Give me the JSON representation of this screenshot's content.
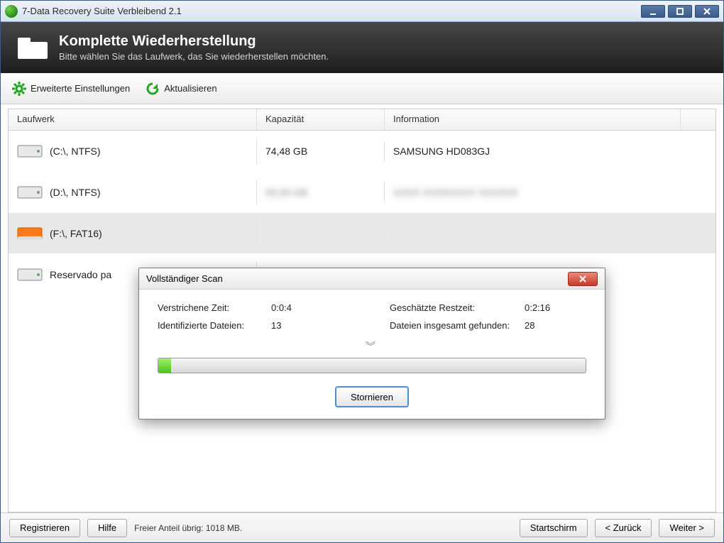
{
  "window": {
    "title": "7-Data Recovery Suite Verbleibend 2.1"
  },
  "banner": {
    "title": "Komplette Wiederherstellung",
    "subtitle": "Bitte wählen Sie das Laufwerk, das Sie wiederherstellen möchten."
  },
  "toolbar": {
    "advanced": "Erweiterte Einstellungen",
    "refresh": "Aktualisieren"
  },
  "columns": {
    "drive": "Laufwerk",
    "capacity": "Kapazität",
    "info": "Information"
  },
  "drives": [
    {
      "label": "(C:\\, NTFS)",
      "capacity": "74,48 GB",
      "info": "SAMSUNG HD083GJ",
      "selected": false,
      "highlight": false
    },
    {
      "label": "(D:\\, NTFS)",
      "capacity": "",
      "info": "",
      "selected": false,
      "highlight": false
    },
    {
      "label": "(F:\\, FAT16)",
      "capacity": "",
      "info": "",
      "selected": true,
      "highlight": true
    },
    {
      "label": "Reservado pa",
      "capacity": "",
      "info": "",
      "selected": false,
      "highlight": false
    }
  ],
  "footer": {
    "register": "Registrieren",
    "help": "Hilfe",
    "status": "Freier Anteil übrig: 1018 MB.",
    "home": "Startschirm",
    "back": "< Zurück",
    "next": "Weiter >"
  },
  "modal": {
    "title": "Vollständiger Scan",
    "elapsed_label": "Verstrichene Zeit:",
    "elapsed_value": "0:0:4",
    "identified_label": "Identifizierte Dateien:",
    "identified_value": "13",
    "remaining_label": "Geschätzte Restzeit:",
    "remaining_value": "0:2:16",
    "total_label": "Dateien insgesamt gefunden:",
    "total_value": "28",
    "cancel": "Stornieren",
    "progress_percent": 3
  }
}
